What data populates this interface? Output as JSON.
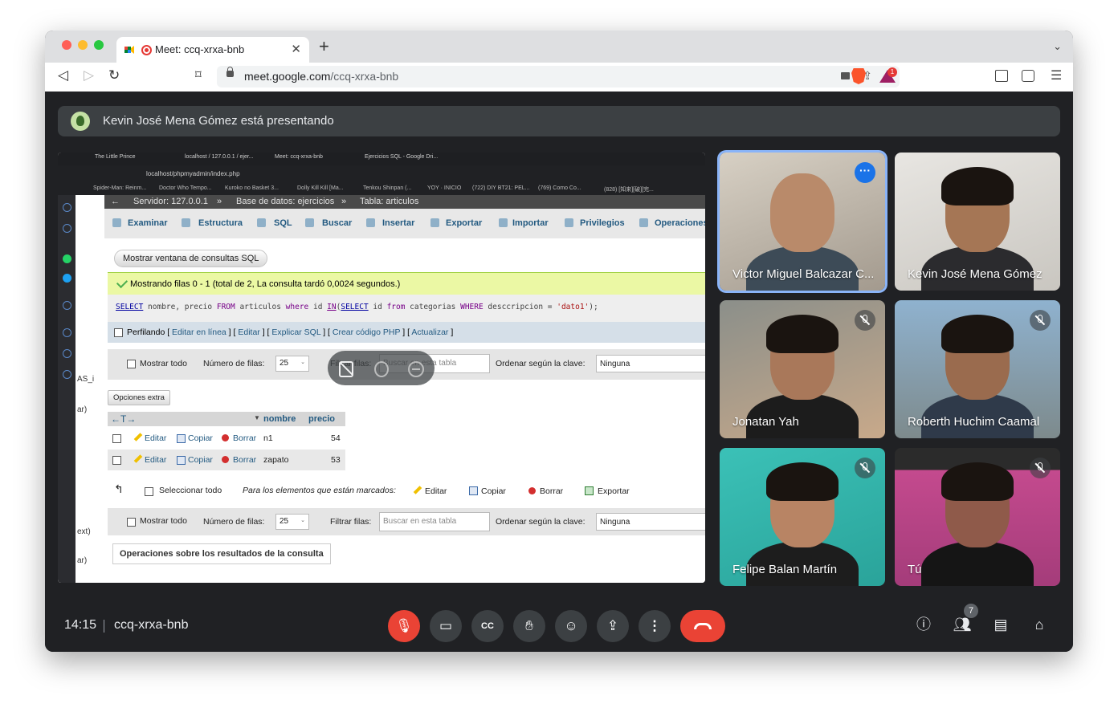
{
  "browser": {
    "tab_title": "Meet: ccq-xrxa-bnb",
    "url_host": "meet.google.com",
    "url_path": "/ccq-xrxa-bnb",
    "bat_badge": "1"
  },
  "meet": {
    "presenting_banner": "Kevin José Mena Gómez está presentando",
    "time": "14:15",
    "meeting_code": "ccq-xrxa-bnb",
    "participants_count": "7",
    "participants": [
      {
        "name": "Victor Miguel Balcazar C...",
        "muted": false,
        "active": true
      },
      {
        "name": "Kevin José Mena Gómez",
        "muted": false,
        "active": false
      },
      {
        "name": "Jonatan Yah",
        "muted": true,
        "active": false
      },
      {
        "name": "Roberth Huchim Caamal",
        "muted": true,
        "active": false
      },
      {
        "name": "Felipe Balan Martín",
        "muted": true,
        "active": false
      },
      {
        "name": "Tú",
        "muted": true,
        "active": false
      }
    ],
    "colors": {
      "accent": "#8ab4f8",
      "end_call": "#ea4335",
      "background": "#202124"
    }
  },
  "shared": {
    "tabs": [
      "The Little Prince",
      "localhost / 127.0.0.1 / ejer...",
      "Meet: ccq-xrxa-bnb",
      "Ejercicios SQL - Google Dri..."
    ],
    "url": "localhost/phpmyadmin/index.php",
    "bookmarks": [
      "Spider-Man: Reinm...",
      "Doctor Who Tempo...",
      "Kuroko no Basket 3...",
      "Dolly Kill Kill [Ma...",
      "Tenkou Shinpan (...",
      "YOY · INICIO",
      "(722) DIY BT21: PEL...",
      "(769) Como Co...",
      "(828) [知来][破][完..."
    ],
    "side_labels": [
      "AS_i",
      "ar)",
      "ext)",
      "ar)"
    ],
    "crumb": {
      "server": "Servidor: 127.0.0.1",
      "db": "Base de datos: ejercicios",
      "table": "Tabla: articulos",
      "sep": "»"
    },
    "nav": [
      "Examinar",
      "Estructura",
      "SQL",
      "Buscar",
      "Insertar",
      "Exportar",
      "Importar",
      "Privilegios",
      "Operaciones"
    ],
    "sql_window_button": "Mostrar ventana de consultas SQL",
    "success_msg": "Mostrando filas 0 - 1 (total de 2, La consulta tardó 0,0024 segundos.)",
    "sql": {
      "p1": "SELECT",
      "p2": " nombre, precio ",
      "p3": "FROM",
      "p4": " articulos ",
      "p5": "where",
      "p6": " id ",
      "p7": "IN",
      "p8": "(",
      "p9": "SELECT",
      "p10": " id ",
      "p11": "from",
      "p12": " categorias ",
      "p13": "WHERE",
      "p14": " desccripcion = ",
      "p15": "'dato1'",
      "p16": ");"
    },
    "profiling": {
      "label": "Perfilando",
      "links": [
        "Editar en línea",
        "Editar",
        "Explicar SQL",
        "Crear código PHP",
        "Actualizar"
      ]
    },
    "filters": {
      "show_all": "Mostrar todo",
      "rows_label": "Número de filas:",
      "rows_value": "25",
      "filter_label": "Filtrar filas:",
      "search_placeholder": "Buscar en esta tabla",
      "sort_label": "Ordenar según la clave:",
      "sort_value": "Ninguna"
    },
    "extra_options": "Opciones extra",
    "table": {
      "arrows": "←T→",
      "columns": [
        "nombre",
        "precio"
      ],
      "rows": [
        {
          "edit": "Editar",
          "copy": "Copiar",
          "delete": "Borrar",
          "nombre": "n1",
          "precio": "54"
        },
        {
          "edit": "Editar",
          "copy": "Copiar",
          "delete": "Borrar",
          "nombre": "zapato",
          "precio": "53"
        }
      ]
    },
    "bulk": {
      "select_all": "Seleccionar todo",
      "for_marked": "Para los elementos que están marcados:",
      "edit": "Editar",
      "copy": "Copiar",
      "delete": "Borrar",
      "export": "Exportar"
    },
    "results_ops": "Operaciones sobre los resultados de la consulta"
  }
}
